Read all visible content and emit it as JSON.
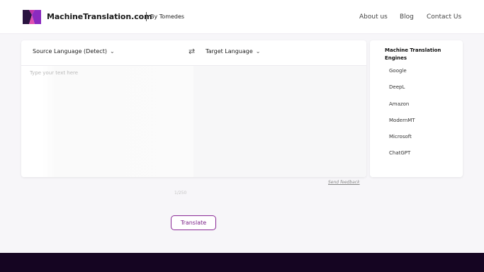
{
  "header": {
    "brand": "MachineTranslation.com",
    "by_line": "By Tomedes",
    "nav": [
      "About us",
      "Blog",
      "Contact Us"
    ]
  },
  "translator": {
    "source_language": "Source Language (Detect)",
    "target_language": "Target Language",
    "swap_glyph": "⇄",
    "source_placeholder": "Type your text here",
    "source_text": "",
    "char_counter": "1/250",
    "feedback_link": "Send feedback"
  },
  "engines": {
    "title": "Machine Translation Engines",
    "items": [
      "Google",
      "DeepL",
      "Amazon",
      "ModernMT",
      "Microsoft",
      "ChatGPT"
    ]
  },
  "actions": {
    "translate_label": "Translate"
  },
  "colors": {
    "brand_purple": "#7a1f87",
    "footer": "#150522",
    "page_bg": "#f7f6f9"
  },
  "icons": {
    "logo": "machinetranslation-logo",
    "chevron": "chevron-down-icon",
    "swap": "swap-arrows-icon"
  }
}
